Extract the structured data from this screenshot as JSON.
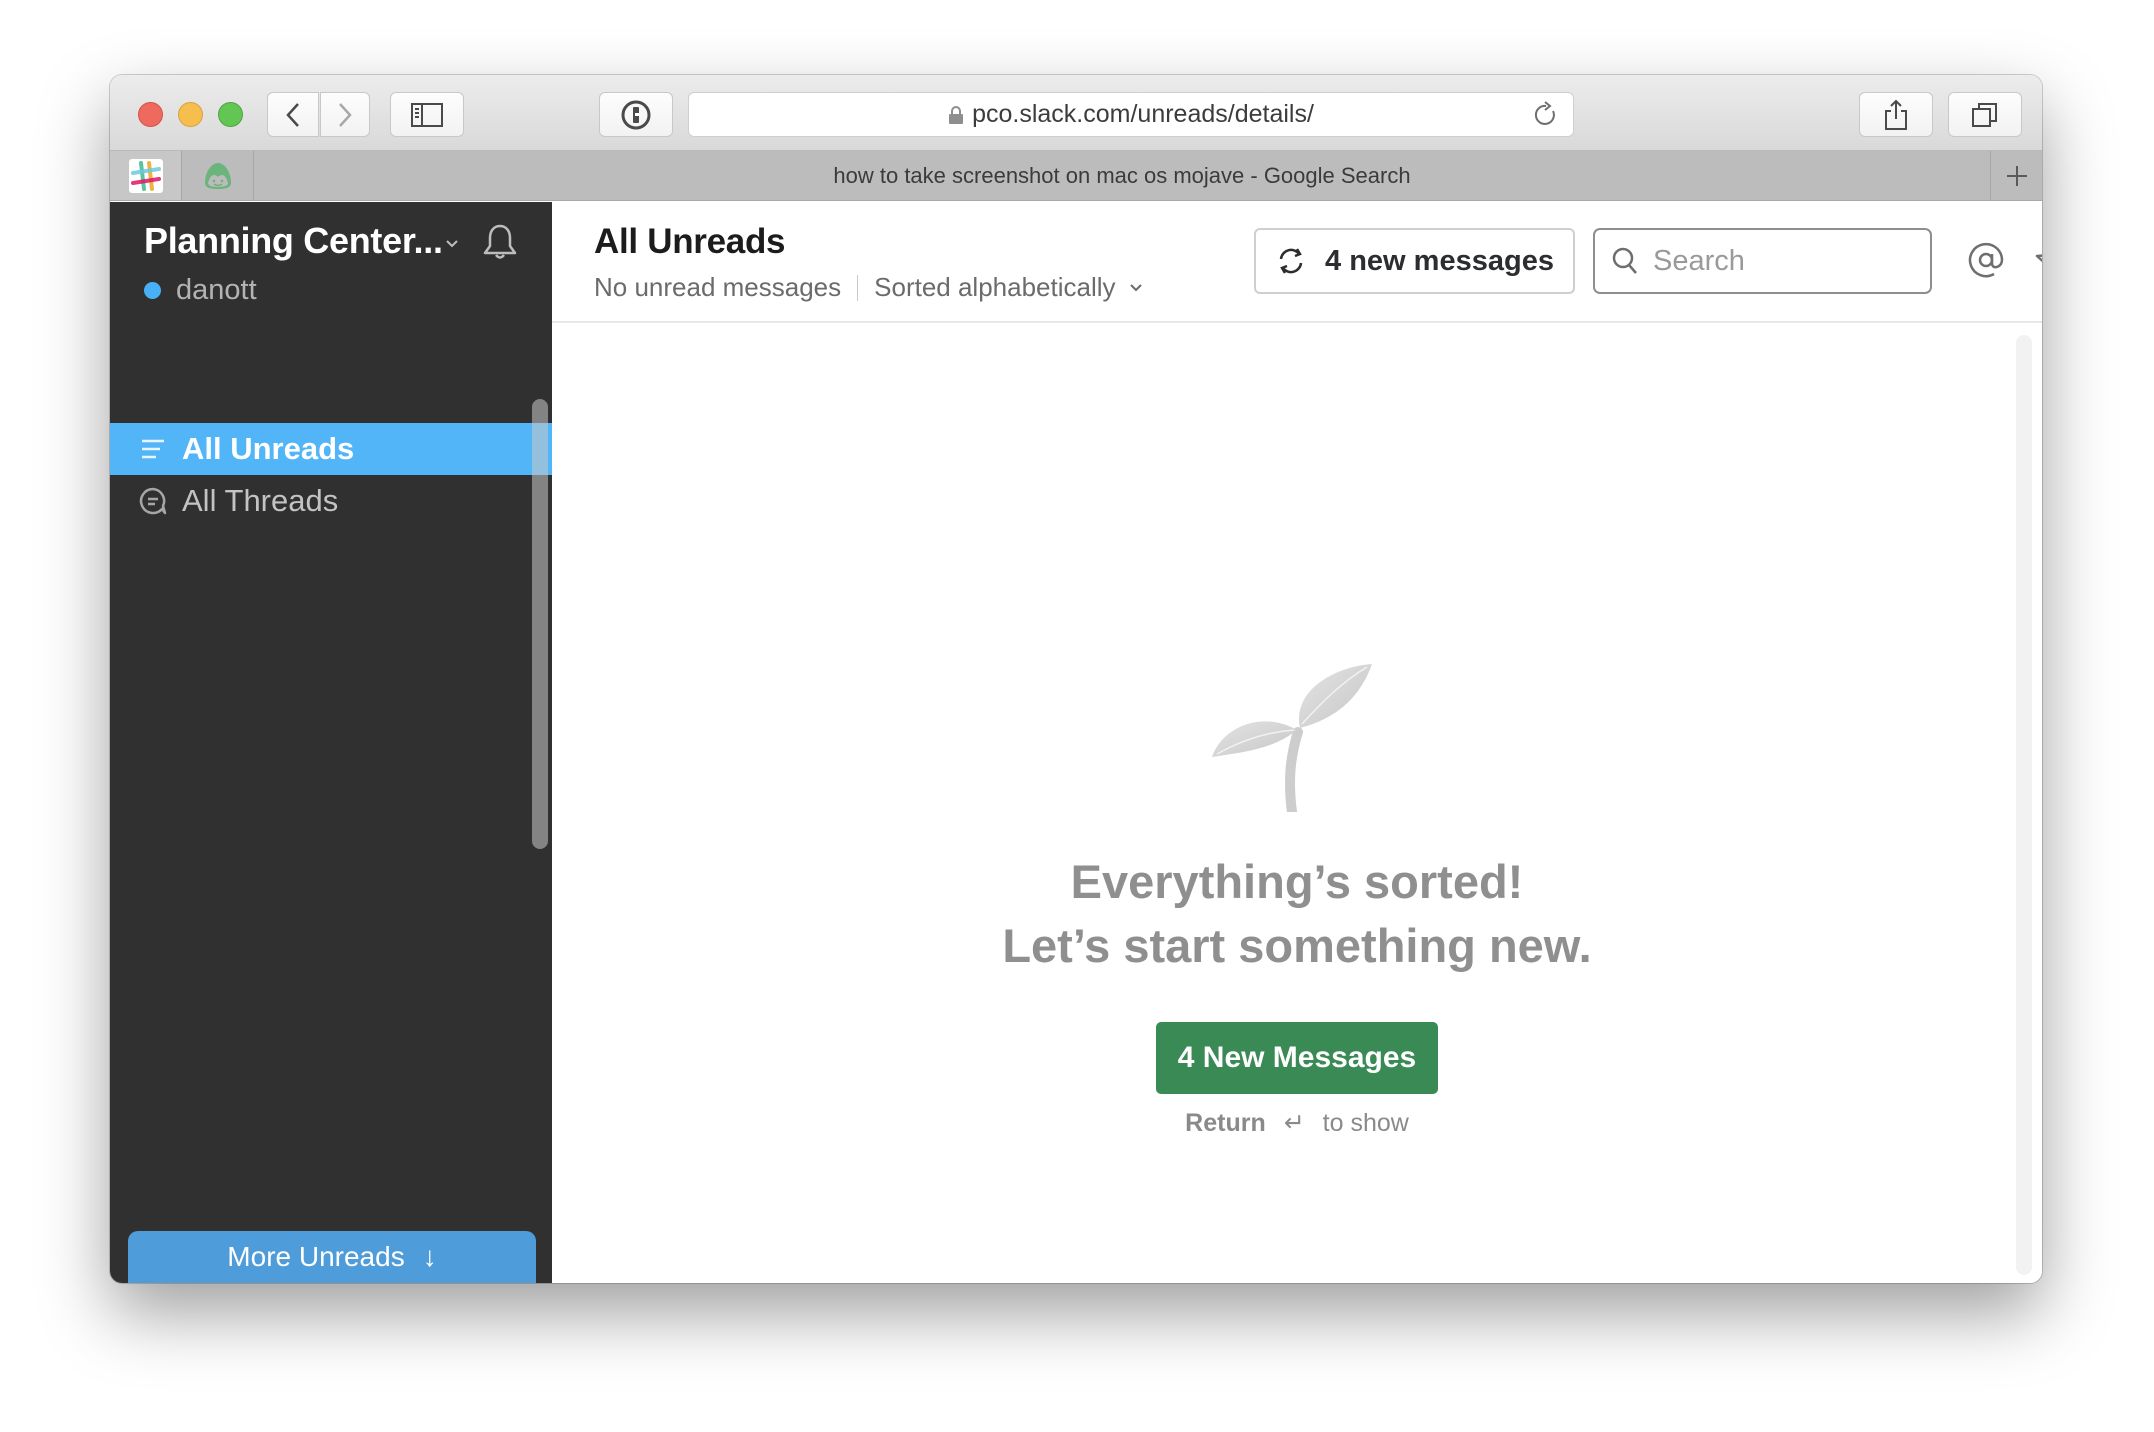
{
  "browser": {
    "url": "pco.slack.com/unreads/details/",
    "active_tab_title": "how to take screenshot on mac os mojave - Google Search",
    "pinned_tabs": [
      "slack-icon",
      "basecamp-icon"
    ],
    "toolbar_icons": [
      "back-icon",
      "forward-icon",
      "sidebar-icon",
      "password-manager-icon",
      "share-icon",
      "tabs-overview-icon"
    ]
  },
  "sidebar": {
    "team_name": "Planning Center...",
    "username": "danott",
    "presence_color": "#48b0f7",
    "items": [
      {
        "label": "All Unreads",
        "icon": "unreads-icon",
        "active": true
      },
      {
        "label": "All Threads",
        "icon": "threads-icon",
        "active": false
      }
    ],
    "more_unreads_label": "More Unreads",
    "more_unreads_arrow": "↓"
  },
  "header": {
    "title": "All Unreads",
    "status": "No unread messages",
    "sort_label": "Sorted alphabetically",
    "new_messages_label": "4 new messages",
    "search_placeholder": "Search"
  },
  "empty_state": {
    "line1": "Everything’s sorted!",
    "line2": "Let’s start something new.",
    "button_label": "4 New Messages",
    "hint_key": "Return",
    "hint_symbol": "↵",
    "hint_text": "to show"
  },
  "colors": {
    "sidebar_bg": "#303030",
    "active_item": "#52b5f7",
    "cta_green": "#3a8a56",
    "more_unreads_blue": "#4f9cda"
  }
}
